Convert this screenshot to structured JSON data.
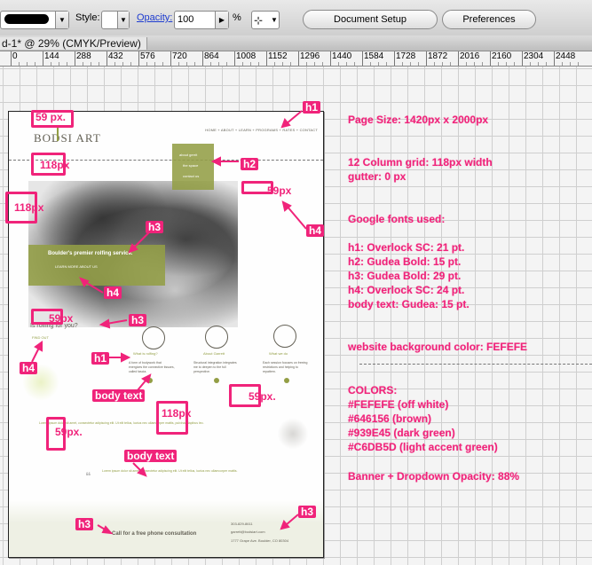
{
  "toolbar": {
    "style_label": "Style:",
    "opacity_label": "Opacity:",
    "opacity_value": "100",
    "percent_label": "%",
    "document_setup_label": "Document Setup",
    "preferences_label": "Preferences"
  },
  "document": {
    "tab_title": "d-1* @ 29% (CMYK/Preview)"
  },
  "ruler": {
    "ticks": [
      "0",
      "144",
      "288",
      "432",
      "576",
      "720",
      "864",
      "1008",
      "1152",
      "1296",
      "1440",
      "1584",
      "1728",
      "1872",
      "2016",
      "2160",
      "2304",
      "2448"
    ]
  },
  "specs": {
    "page_size": "Page Size: 1420px x 2000px",
    "grid_line1": "12 Column grid: 118px width",
    "grid_line2": "gutter: 0 px",
    "fonts_title": "Google fonts used:",
    "font_h1": "h1: Overlock SC: 21 pt.",
    "font_h2": "h2: Gudea Bold: 15 pt.",
    "font_h3": "h3: Gudea Bold: 29 pt.",
    "font_h4": "h4: Overlock SC: 24 pt.",
    "font_body": "body text: Gudea: 15 pt.",
    "bg_color": "website background color: FEFEFE",
    "colors_title": "COLORS:",
    "color1": "#FEFEFE (off white)",
    "color2": "#646156 (brown)",
    "color3": "#939E45 (dark green)",
    "color4": "#C6DB5D (light accent green)",
    "opacity_note": "Banner + Dropdown Opacity: 88%"
  },
  "markers": {
    "m59a": "59 px.",
    "m118a": "118px",
    "m118b": "118px",
    "m59b": "59px",
    "m59c": "59px",
    "m118c": "118px",
    "m59d": "59px.",
    "m59e": "59px.",
    "h1a": "h1",
    "h2a": "h2",
    "h3a": "h3",
    "h4a": "h4",
    "h4b": "h4",
    "h3b": "h3",
    "h1b": "h1",
    "h4c": "h4",
    "body1": "body text",
    "body2": "body text",
    "h3c": "h3",
    "h3d": "h3"
  },
  "site": {
    "logo": "BODSI ART",
    "nav": "HOME  +  ABOUT  +  LEARN  +  PROGRAMS + RATES  +  CONTACT",
    "dropdown1": "about gerrit",
    "dropdown2": "the space",
    "dropdown3": "contact us",
    "banner_title": "Boulder's premier rolfing service.",
    "banner_link": "LEARN MORE ABOUT US",
    "section_title": "Is rolfing for you?",
    "section_sub": "FIND OUT",
    "col1_title": "What is rolfing?",
    "col2_title": "About Garrett",
    "col3_title": "What we do",
    "col1_text": "A form of bodywork that energizes the connective tissues, called fascia.",
    "col2_text": "Structural integration integrates me to deepen to the full perspective.",
    "col3_text": "Each session focuses on freeing restrictions and helping to repattern.",
    "body_para": "Lorem ipsum dolor sit amet, consectetur adipiscing elit. Ut elit tellus, luctus nec ullamcorper mattis, pulvinar dapibus leo.",
    "body_para2": "Lorem ipsum dolor sit amet, consectetur adipiscing elit. Ut elit tellus, luctus nec ullamcorper mattis.",
    "cta": "Call for a free phone consultation",
    "phone": "303-829-8611",
    "email": "garrett@bodsiart.com",
    "address": "1777 Grape Ave. Boulder, CO 80304"
  },
  "colors": {
    "accent": "#f0237a",
    "brown": "#646156",
    "dark_green": "#939E45",
    "light_green": "#C6DB5D",
    "offwhite": "#FEFEFE"
  }
}
